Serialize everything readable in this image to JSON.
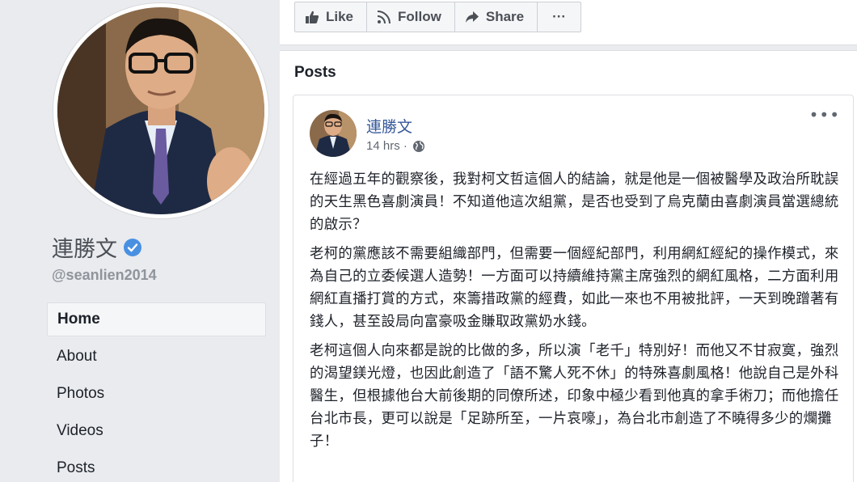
{
  "profile": {
    "name": "連勝文",
    "handle": "@seanlien2014",
    "verified": true
  },
  "nav": {
    "items": [
      {
        "label": "Home",
        "active": true
      },
      {
        "label": "About",
        "active": false
      },
      {
        "label": "Photos",
        "active": false
      },
      {
        "label": "Videos",
        "active": false
      },
      {
        "label": "Posts",
        "active": false
      }
    ]
  },
  "actions": {
    "like_label": "Like",
    "follow_label": "Follow",
    "share_label": "Share",
    "more_label": "···"
  },
  "posts": {
    "title": "Posts",
    "post": {
      "author": "連勝文",
      "time": "14 hrs ·",
      "more": "•••",
      "paragraphs": [
        "在經過五年的觀察後，我對柯文哲這個人的結論，就是他是一個被醫學及政治所耽誤的天生黑色喜劇演員！不知道他這次組黨，是否也受到了烏克蘭由喜劇演員當選總統的啟示？",
        "老柯的黨應該不需要組織部門，但需要一個經紀部門，利用網紅經紀的操作模式，來為自己的立委候選人造勢！一方面可以持續維持黨主席強烈的網紅風格，二方面利用網紅直播打賞的方式，來籌措政黨的經費，如此一來也不用被批評，一天到晚蹭著有錢人，甚至設局向富豪吸金賺取政黨奶水錢。",
        "老柯這個人向來都是說的比做的多，所以演「老千」特別好！而他又不甘寂寞，強烈的渴望鎂光燈，也因此創造了「語不驚人死不休」的特殊喜劇風格！他說自己是外科醫生，但根據他台大前後期的同僚所述，印象中極少看到他真的拿手術刀；而他擔任台北市長，更可以說是「足跡所至，一片哀嚎」，為台北市創造了不曉得多少的爛攤子！"
      ]
    }
  },
  "colors": {
    "link": "#365899",
    "verified": "#4a90e2",
    "background": "#e9ebee"
  }
}
